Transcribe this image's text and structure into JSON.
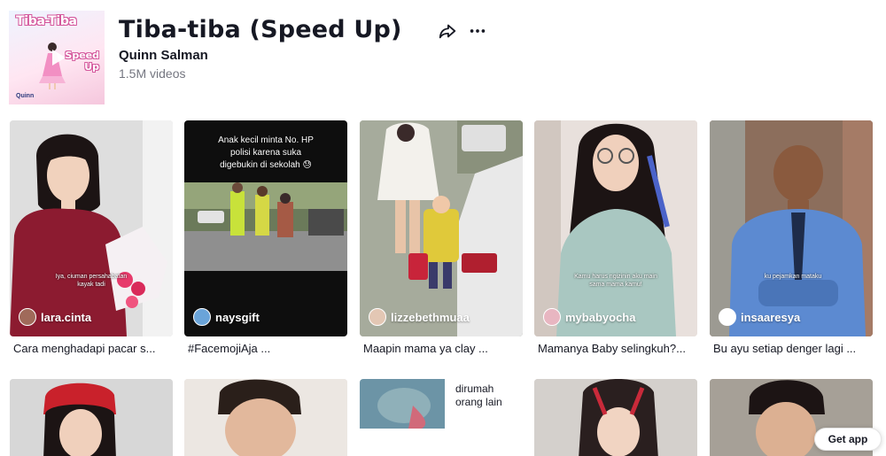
{
  "header": {
    "cover_title": "Tiba-Tiba",
    "cover_subtitle_line1": "Speed",
    "cover_subtitle_line2": "Up",
    "cover_logo": "Quinn",
    "title": "Tiba-tiba (Speed Up)",
    "artist": "Quinn Salman",
    "video_count": "1.5M videos",
    "share_icon": "share-icon",
    "more_icon": "more-icon"
  },
  "videos": [
    {
      "author": "lara.cinta",
      "caption": "Cara menghadapi pacar s...",
      "overlay": "Iya, ciuman persahabatan\nkayak tadi"
    },
    {
      "author": "naysgift",
      "caption": "#FacemojiAja ...",
      "overlay": "Anak kecil minta No. HP\npolisi karena suka\ndigebukin di sekolah 😓"
    },
    {
      "author": "lizzebethmuaa",
      "caption": "Maapin mama ya clay ...",
      "overlay": ""
    },
    {
      "author": "mybabyocha",
      "caption": "Mamanya Baby selingkuh?...",
      "overlay": "Kamu harus ngizinin aku main\nsama mama kamu"
    },
    {
      "author": "insaaresya",
      "caption": "Bu ayu setiap denger lagi ...",
      "overlay": "ku pejamkan mataku"
    }
  ],
  "row2": {
    "card3_text_line1": "dirumah",
    "card3_text_line2": "orang lain"
  },
  "get_app_label": "Get app",
  "colors": {
    "text_primary": "#161823",
    "text_secondary": "#747680",
    "accent_pink": "#d4579c"
  }
}
